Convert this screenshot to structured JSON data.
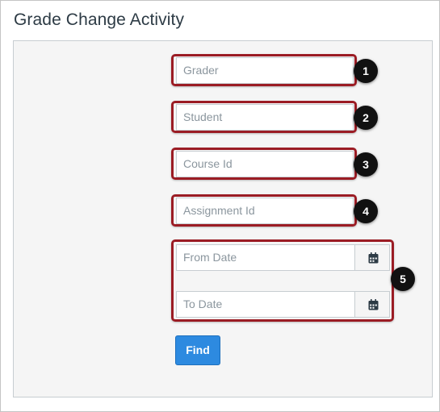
{
  "page": {
    "title": "Grade Change Activity"
  },
  "form": {
    "grader": {
      "placeholder": "Grader",
      "value": ""
    },
    "student": {
      "placeholder": "Student",
      "value": ""
    },
    "course_id": {
      "placeholder": "Course Id",
      "value": ""
    },
    "assignment_id": {
      "placeholder": "Assignment Id",
      "value": ""
    },
    "from_date": {
      "placeholder": "From Date",
      "value": ""
    },
    "to_date": {
      "placeholder": "To Date",
      "value": ""
    },
    "find_label": "Find"
  },
  "callouts": [
    "1",
    "2",
    "3",
    "4",
    "5"
  ],
  "colors": {
    "highlight_border": "#9b1c24",
    "badge_bg": "#111111",
    "find_button": "#2d8ae0",
    "title_text": "#2d3b45"
  },
  "icons": {
    "date_picker": "calendar-icon"
  }
}
